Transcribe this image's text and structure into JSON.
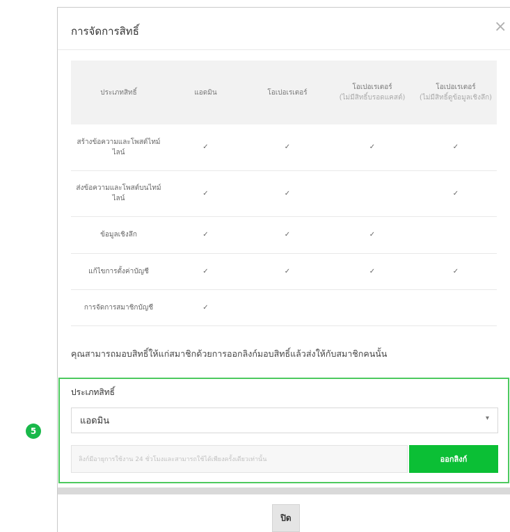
{
  "step_badge": "5",
  "modal": {
    "title": "การจัดการสิทธิ์",
    "close_icon": "×"
  },
  "table": {
    "headers": [
      {
        "label": "ประเภทสิทธิ์",
        "sub": ""
      },
      {
        "label": "แอดมิน",
        "sub": ""
      },
      {
        "label": "โอเปอเรเตอร์",
        "sub": ""
      },
      {
        "label": "โอเปอเรเตอร์",
        "sub": "(ไม่มีสิทธิ์บรอดแคสต์)"
      },
      {
        "label": "โอเปอเรเตอร์",
        "sub": "(ไม่มีสิทธิ์ดูข้อมูลเชิงลึก)"
      }
    ],
    "rows": [
      {
        "label": "สร้างข้อความและโพสต์ไทม์ไลน์",
        "checks": [
          "✓",
          "✓",
          "✓",
          "✓"
        ]
      },
      {
        "label": "ส่งข้อความและโพสต์บนไทม์ไลน์",
        "checks": [
          "✓",
          "✓",
          "",
          "✓"
        ]
      },
      {
        "label": "ข้อมูลเชิงลึก",
        "checks": [
          "✓",
          "✓",
          "✓",
          ""
        ]
      },
      {
        "label": "แก้ไขการตั้งค่าบัญชี",
        "checks": [
          "✓",
          "✓",
          "✓",
          "✓"
        ]
      },
      {
        "label": "การจัดการสมาชิกบัญชี",
        "checks": [
          "✓",
          "",
          "",
          ""
        ]
      }
    ]
  },
  "note": "คุณสามารถมอบสิทธิ์ให้แก่สมาชิกด้วยการออกลิงก์มอบสิทธิ์แล้วส่งให้กับสมาชิกคนนั้น",
  "role_panel": {
    "label": "ประเภทสิทธิ์",
    "selected": "แอดมิน",
    "chevron": "▾",
    "invite_placeholder": "ลิงก์มีอายุการใช้งาน 24 ชั่วโมงและสามารถใช้ได้เพียงครั้งเดียวเท่านั้น",
    "invite_button": "ออกลิงก์"
  },
  "footer": {
    "close_label": "ปิด"
  }
}
